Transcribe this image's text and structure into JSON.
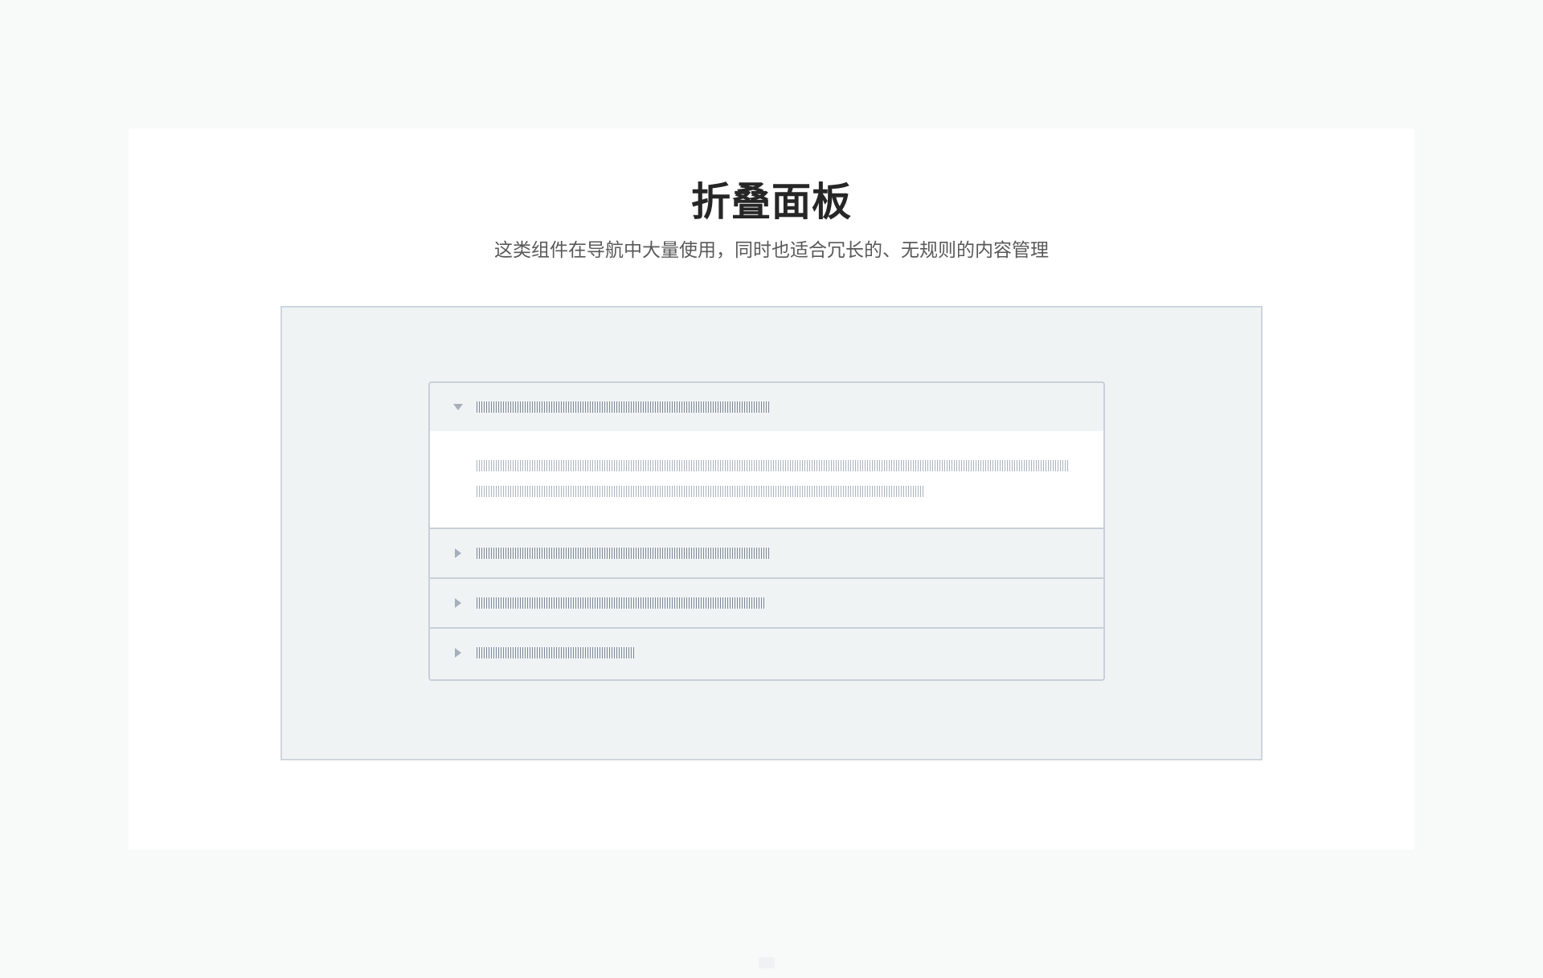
{
  "page": {
    "title": "折叠面板",
    "subtitle": "这类组件在导航中大量使用，同时也适合冗长的、无规则的内容管理"
  },
  "collapse": {
    "panels": [
      {
        "expanded": true,
        "arrow": "caret-down-icon"
      },
      {
        "expanded": false,
        "arrow": "caret-right-icon"
      },
      {
        "expanded": false,
        "arrow": "caret-right-icon"
      },
      {
        "expanded": false,
        "arrow": "caret-right-icon"
      }
    ]
  },
  "colors": {
    "page_background": "#f8f9f9",
    "card_background": "#ffffff",
    "frame_background": "#f0f3f4",
    "border": "#c8d0d8",
    "header_text_placeholder": "#7c8796",
    "body_text_placeholder": "#a9b3be",
    "arrow": "#a6b0bb",
    "title": "#262626",
    "subtitle": "#595959"
  }
}
